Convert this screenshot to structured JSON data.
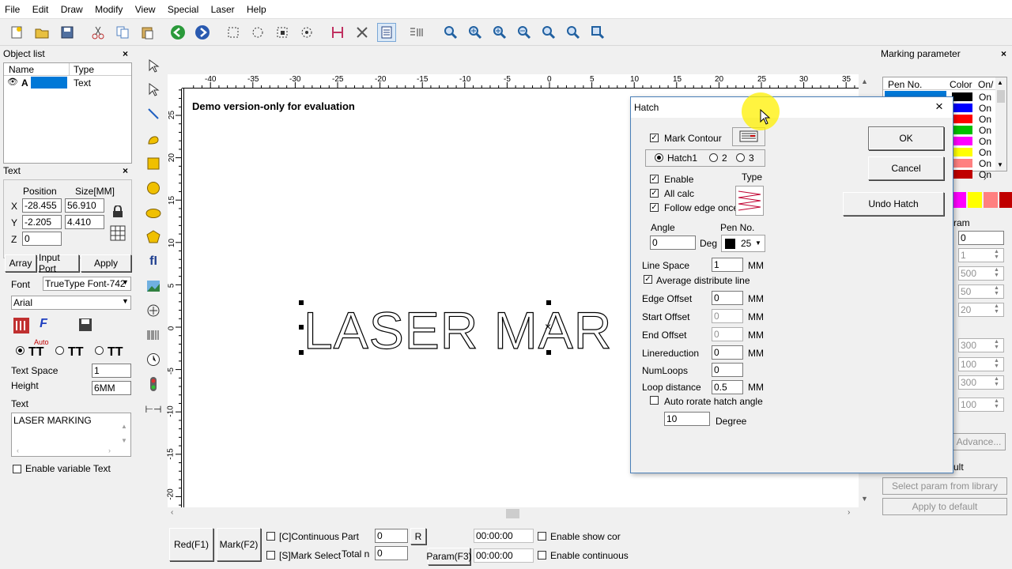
{
  "menu": [
    "File",
    "Edit",
    "Draw",
    "Modify",
    "View",
    "Special",
    "Laser",
    "Help"
  ],
  "object_list": {
    "title": "Object list",
    "col_name": "Name",
    "col_type": "Type",
    "row_name": "A",
    "row_type": "Text"
  },
  "text_panel": {
    "title": "Text",
    "position_label": "Position",
    "size_label": "Size[MM]",
    "x_label": "X",
    "y_label": "Y",
    "z_label": "Z",
    "x_pos": "-28.455",
    "x_size": "56.910",
    "y_pos": "-2.205",
    "y_size": "4.410",
    "z_pos": "0",
    "array_btn": "Array",
    "input_port_btn": "Input Port",
    "apply_btn": "Apply",
    "font_label": "Font",
    "font_type": "TrueType Font-742",
    "font_name": "Arial",
    "auto_label": "Auto",
    "text_space_label": "Text Space",
    "text_space_value": "1",
    "height_label": "Height",
    "height_value": "6MM",
    "text_label": "Text",
    "text_value": "LASER  MARKING",
    "enable_variable": "Enable variable Text"
  },
  "canvas": {
    "demo_text": "Demo version-only for evaluation",
    "big_text": "LASER  MAR",
    "ruler_top": [
      "-40",
      "-35",
      "-30",
      "-25",
      "-20",
      "-15",
      "-10",
      "-5",
      "0",
      "5",
      "10",
      "15",
      "20",
      "25",
      "30",
      "35"
    ],
    "ruler_left": [
      "25",
      "20",
      "15",
      "10",
      "5",
      "0",
      "-5",
      "-10",
      "-15",
      "-20"
    ]
  },
  "bottom": {
    "red_btn": "Red(F1)",
    "mark_btn": "Mark(F2)",
    "continuous": "[C]Continuous",
    "mark_select": "[S]Mark Select",
    "part_label": "Part",
    "part_value": "0",
    "r_btn": "R",
    "total_label": "Total n",
    "total_value": "0",
    "time1": "00:00:00",
    "time2": "00:00:00",
    "param_btn": "Param(F3)",
    "enable_show": "Enable show cor",
    "enable_cont": "Enable continuous"
  },
  "marking": {
    "title": "Marking parameter",
    "col_pen": "Pen No.",
    "col_color": "Color",
    "col_on": "On/",
    "on_values": [
      "On",
      "On",
      "On",
      "On",
      "On",
      "On",
      "On",
      "On"
    ],
    "pen_colors": [
      "#000000",
      "#0000ff",
      "#ff0000",
      "#00c000",
      "#ff00ff",
      "#ffff00",
      "#ff8080",
      "#c00000"
    ],
    "swatches": [
      "#ff00ff",
      "#ffff00",
      "#ff8080",
      "#c00000"
    ],
    "param_label": "ram",
    "values": [
      "0",
      "1",
      "500",
      "50",
      "20",
      "300",
      "100",
      "300",
      "100"
    ],
    "advance_btn": "Advance...",
    "lt_label": "ult",
    "select_lib": "Select param from library",
    "apply_default": "Apply to default"
  },
  "hatch": {
    "title": "Hatch",
    "mark_contour": "Mark Contour",
    "hatch1": "Hatch1",
    "hatch2": "2",
    "hatch3": "3",
    "enable": "Enable",
    "all_calc": "All calc",
    "follow_edge": "Follow edge once",
    "type_label": "Type",
    "angle_label": "Angle",
    "angle_value": "0",
    "deg_label": "Deg",
    "pen_label": "Pen No.",
    "pen_value": "25",
    "line_space_label": "Line Space",
    "line_space_value": "1",
    "avg_line": "Average distribute line",
    "edge_offset_label": "Edge Offset",
    "edge_offset_value": "0",
    "start_offset_label": "Start Offset",
    "start_offset_value": "0",
    "end_offset_label": "End Offset",
    "end_offset_value": "0",
    "linereduction_label": "Linereduction",
    "linereduction_value": "0",
    "numloops_label": "NumLoops",
    "numloops_value": "0",
    "loop_distance_label": "Loop distance",
    "loop_distance_value": "0.5",
    "mm": "MM",
    "auto_rotate": "Auto rorate hatch angle",
    "degree_value": "10",
    "degree_label": "Degree",
    "ok": "OK",
    "cancel": "Cancel",
    "undo": "Undo Hatch"
  }
}
